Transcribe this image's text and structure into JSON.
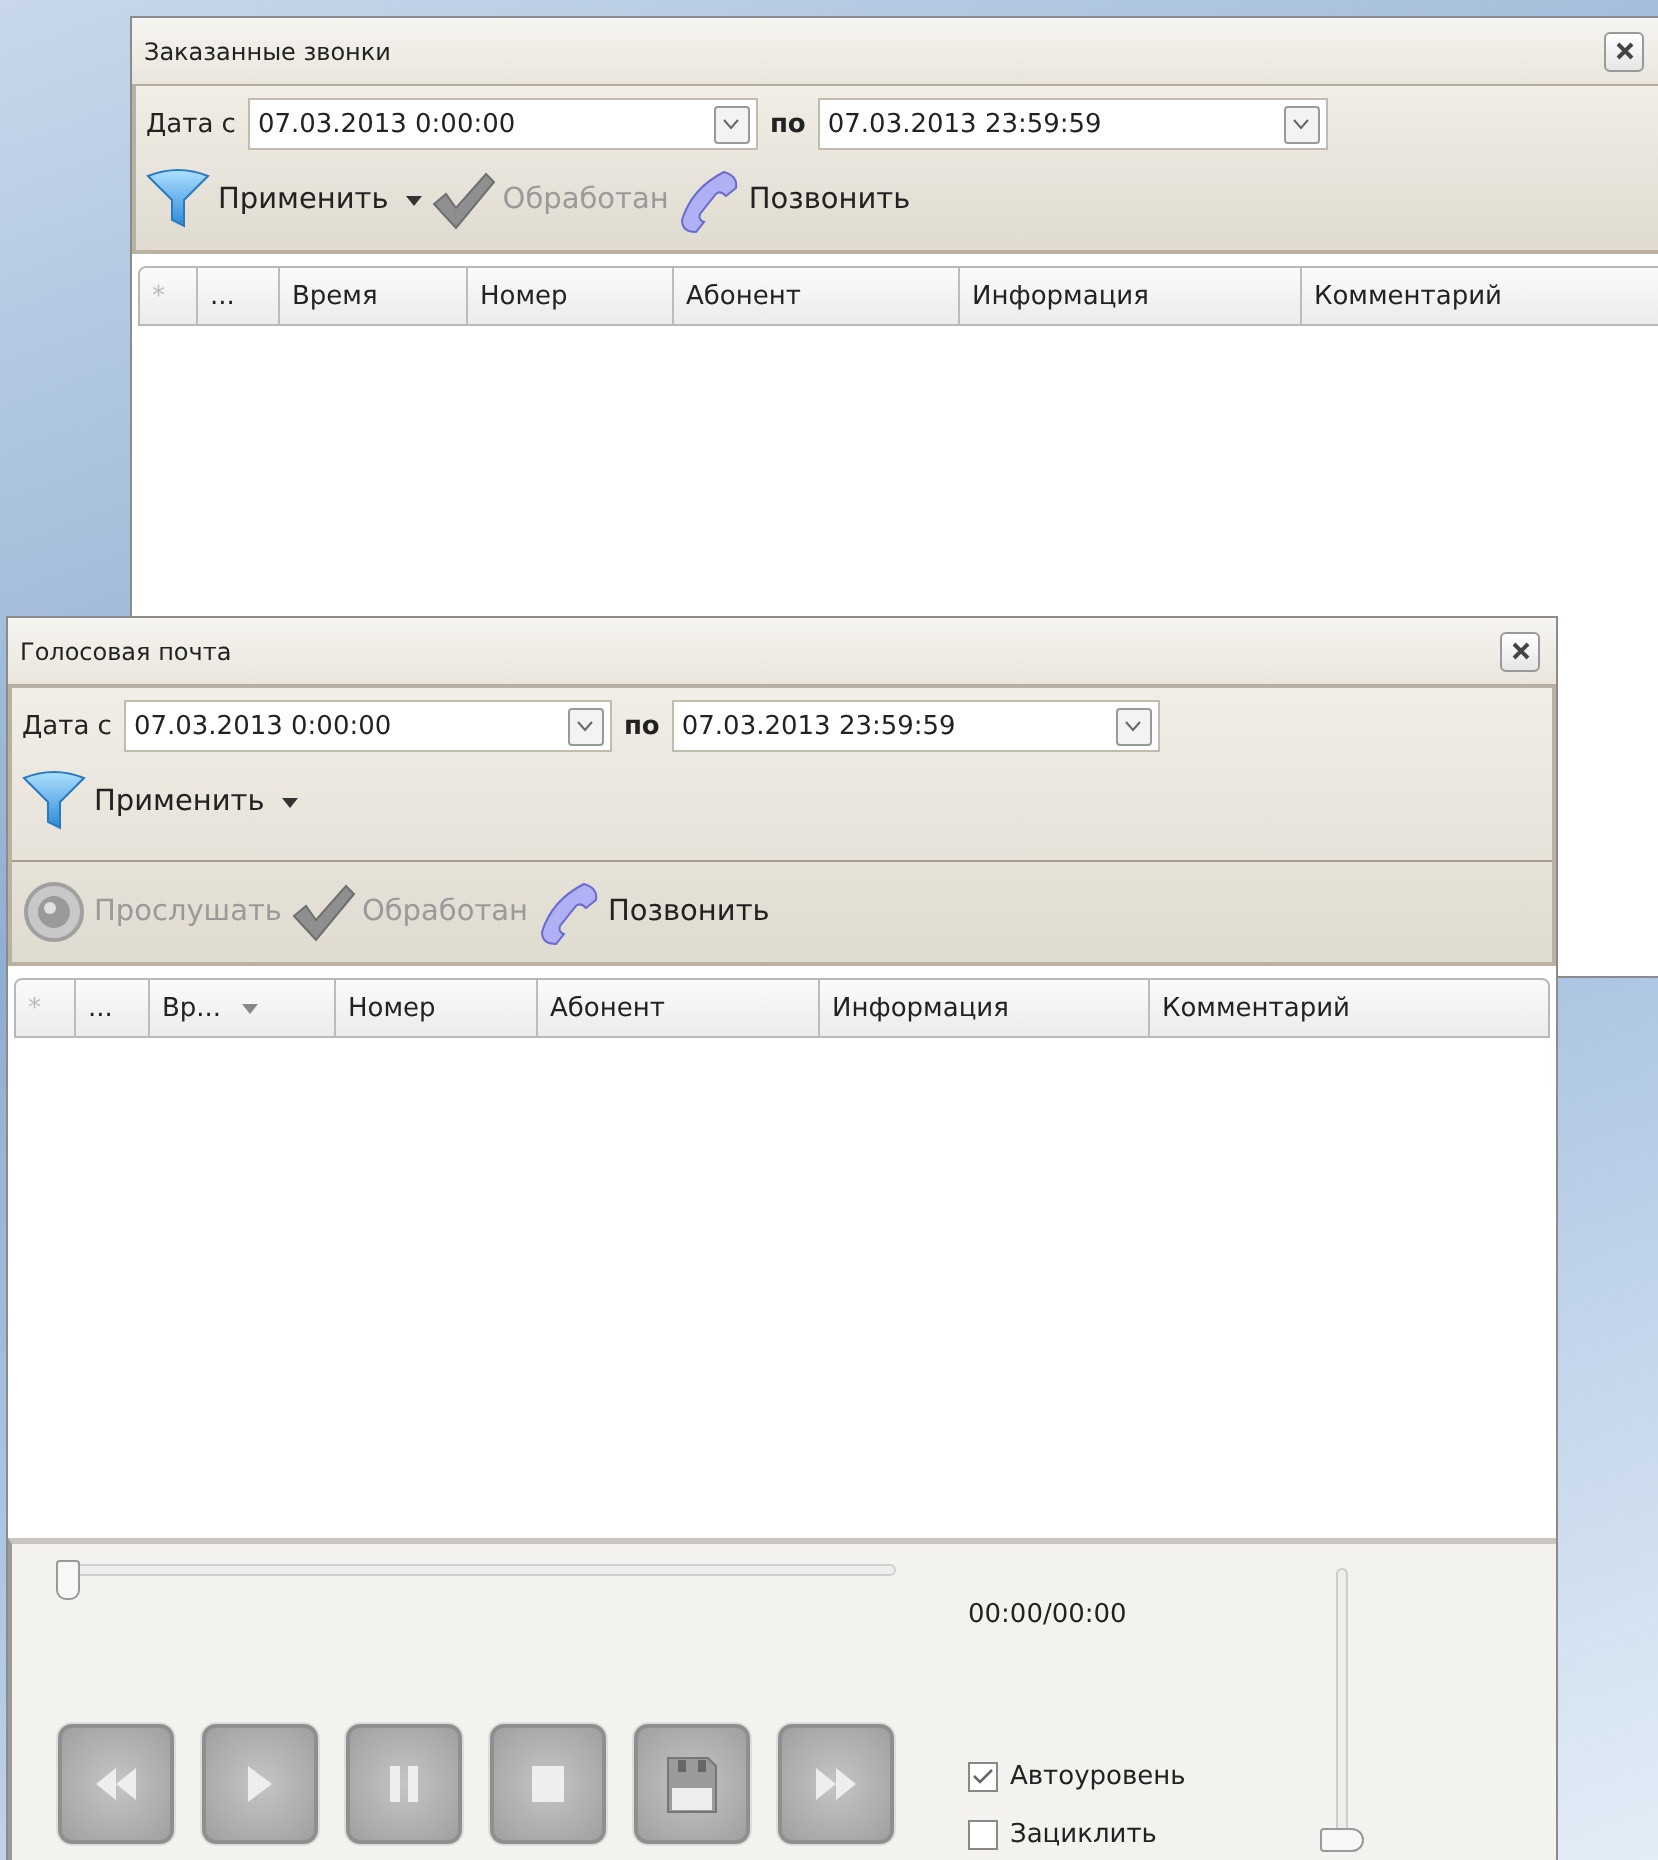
{
  "windows": [
    {
      "title": "Заказанные звонки",
      "filter": {
        "from_label": "Дата с",
        "from_value": "07.03.2013 0:00:00",
        "to_label": "по",
        "to_value": "07.03.2013 23:59:59"
      },
      "toolbar_rows": [
        [
          {
            "kind": "apply",
            "label": "Применить",
            "disabled": false
          },
          {
            "kind": "processed",
            "label": "Обработан",
            "disabled": true
          },
          {
            "kind": "call",
            "label": "Позвонить",
            "disabled": false
          }
        ]
      ],
      "columns": [
        {
          "label": "*",
          "kind": "star",
          "sorted": false
        },
        {
          "label": "...",
          "kind": "more",
          "sorted": false
        },
        {
          "label": "Время",
          "kind": "text",
          "sorted": false
        },
        {
          "label": "Номер",
          "kind": "text",
          "sorted": false
        },
        {
          "label": "Абонент",
          "kind": "text",
          "sorted": false
        },
        {
          "label": "Информация",
          "kind": "text",
          "sorted": false
        },
        {
          "label": "Комментарий",
          "kind": "text",
          "sorted": false
        }
      ]
    },
    {
      "title": "Голосовая почта",
      "filter": {
        "from_label": "Дата с",
        "from_value": "07.03.2013 0:00:00",
        "to_label": "по",
        "to_value": "07.03.2013 23:59:59"
      },
      "toolbar_rows": [
        [
          {
            "kind": "apply",
            "label": "Применить",
            "disabled": false
          }
        ],
        [
          {
            "kind": "listen",
            "label": "Прослушать",
            "disabled": true
          },
          {
            "kind": "processed",
            "label": "Обработан",
            "disabled": true
          },
          {
            "kind": "call",
            "label": "Позвонить",
            "disabled": false
          }
        ]
      ],
      "columns": [
        {
          "label": "*",
          "kind": "star",
          "sorted": false
        },
        {
          "label": "...",
          "kind": "more",
          "sorted": false
        },
        {
          "label": "Вр...",
          "kind": "text",
          "sorted": true
        },
        {
          "label": "Номер",
          "kind": "text",
          "sorted": false
        },
        {
          "label": "Абонент",
          "kind": "text",
          "sorted": false
        },
        {
          "label": "Информация",
          "kind": "text",
          "sorted": false
        },
        {
          "label": "Комментарий",
          "kind": "text",
          "sorted": false
        }
      ],
      "player": {
        "position": {
          "level": 0
        },
        "time": "00:00/00:00",
        "buttons": [
          {
            "kind": "rewind",
            "disabled": true
          },
          {
            "kind": "play",
            "disabled": true
          },
          {
            "kind": "pause",
            "disabled": true
          },
          {
            "kind": "stop",
            "disabled": true
          },
          {
            "kind": "save",
            "disabled": true
          },
          {
            "kind": "forward",
            "disabled": true
          }
        ],
        "options": [
          {
            "label": "Автоуровень",
            "checked": true
          },
          {
            "label": "Зациклить",
            "checked": false
          }
        ],
        "volume": {
          "level": 0
        }
      }
    }
  ]
}
